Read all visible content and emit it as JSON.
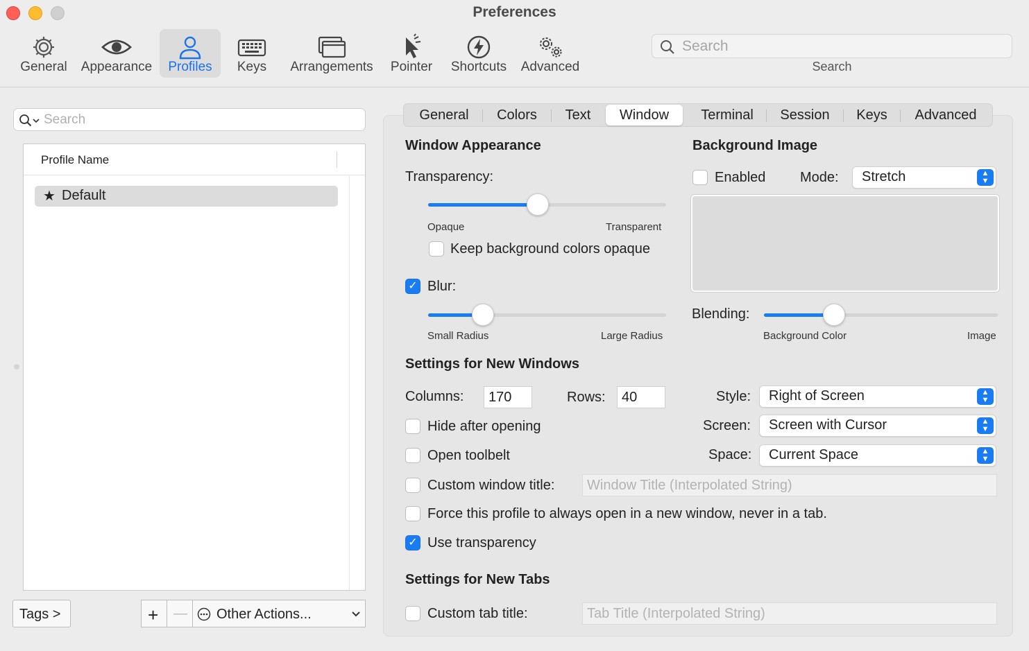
{
  "window": {
    "title": "Preferences"
  },
  "toolbar": {
    "items": [
      {
        "label": "General",
        "icon": "gear-icon"
      },
      {
        "label": "Appearance",
        "icon": "eye-icon"
      },
      {
        "label": "Profiles",
        "icon": "person-icon"
      },
      {
        "label": "Keys",
        "icon": "keyboard-icon"
      },
      {
        "label": "Arrangements",
        "icon": "windows-icon"
      },
      {
        "label": "Pointer",
        "icon": "pointer-icon"
      },
      {
        "label": "Shortcuts",
        "icon": "lightning-icon"
      },
      {
        "label": "Advanced",
        "icon": "gears-icon"
      }
    ],
    "active": "Profiles",
    "search": {
      "placeholder": "Search",
      "label": "Search"
    }
  },
  "profiles": {
    "search_placeholder": "Search",
    "column_header": "Profile Name",
    "items": [
      {
        "name": "Default",
        "default": true
      }
    ],
    "tags_button": "Tags >",
    "add_button": "+",
    "remove_button": "—",
    "other_actions": "Other Actions..."
  },
  "tabs": {
    "items": [
      "General",
      "Colors",
      "Text",
      "Window",
      "Terminal",
      "Session",
      "Keys",
      "Advanced"
    ],
    "selected": "Window"
  },
  "window_appearance": {
    "heading": "Window Appearance",
    "transparency_label": "Transparency:",
    "transparency_value": 0.46,
    "transparency_min": "Opaque",
    "transparency_max": "Transparent",
    "keep_opaque_label": "Keep background colors opaque",
    "keep_opaque_checked": false,
    "blur_label": "Blur:",
    "blur_checked": true,
    "blur_value": 0.23,
    "blur_min": "Small Radius",
    "blur_max": "Large Radius"
  },
  "background_image": {
    "heading": "Background Image",
    "enabled_label": "Enabled",
    "enabled_checked": false,
    "mode_label": "Mode:",
    "mode_value": "Stretch",
    "blending_label": "Blending:",
    "blending_value": 0.3,
    "blending_min": "Background Color",
    "blending_max": "Image"
  },
  "new_windows": {
    "heading": "Settings for New Windows",
    "columns_label": "Columns:",
    "columns_value": "170",
    "rows_label": "Rows:",
    "rows_value": "40",
    "style_label": "Style:",
    "style_value": "Right of Screen",
    "screen_label": "Screen:",
    "screen_value": "Screen with Cursor",
    "space_label": "Space:",
    "space_value": "Current Space",
    "hide_after_opening": "Hide after opening",
    "open_toolbelt": "Open toolbelt",
    "custom_window_title": "Custom window title:",
    "window_title_placeholder": "Window Title (Interpolated String)",
    "force_new_window": "Force this profile to always open in a new window, never in a tab.",
    "use_transparency": "Use transparency",
    "use_transparency_checked": true
  },
  "new_tabs": {
    "heading": "Settings for New Tabs",
    "custom_tab_title": "Custom tab title:",
    "tab_title_placeholder": "Tab Title (Interpolated String)"
  },
  "colors": {
    "accent": "#1a7cf3",
    "close": "#fe5f57",
    "minimize": "#febc2e"
  }
}
